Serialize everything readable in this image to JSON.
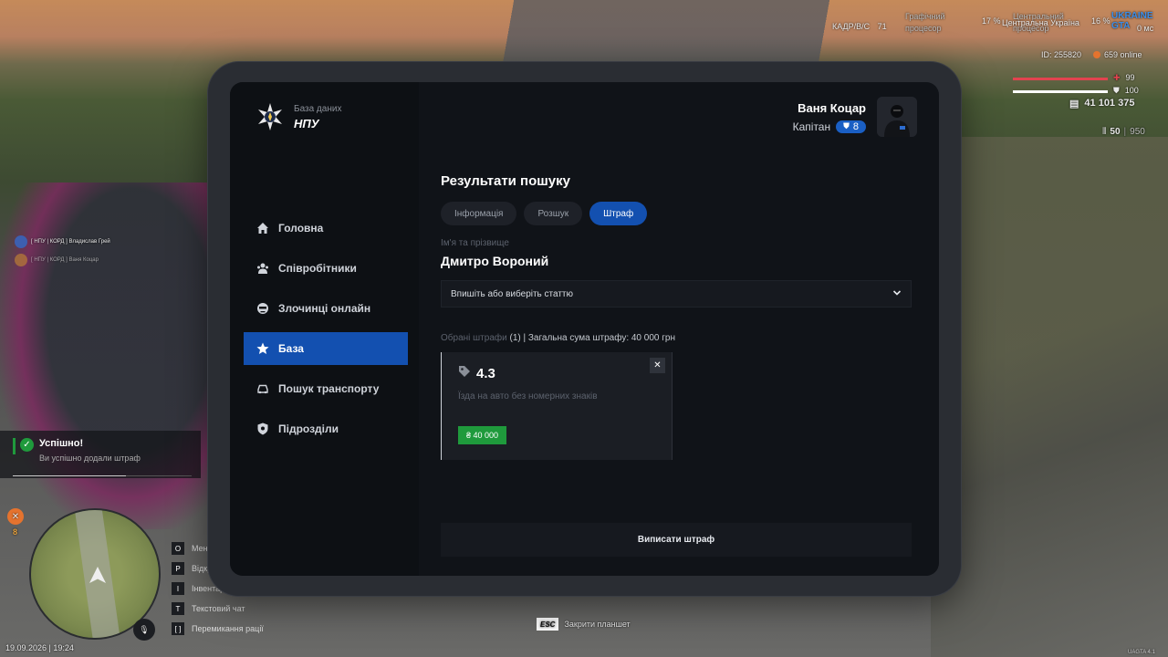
{
  "app": {
    "brand_subtitle": "База даних",
    "brand_title": "НПУ"
  },
  "user": {
    "name": "Ваня Коцар",
    "rank": "Капітан",
    "level": "8"
  },
  "sidebar": {
    "items": [
      {
        "label": "Головна",
        "icon": "home-icon"
      },
      {
        "label": "Співробітники",
        "icon": "users-icon"
      },
      {
        "label": "Злочинці онлайн",
        "icon": "criminal-icon"
      },
      {
        "label": "База",
        "icon": "star-icon",
        "active": true
      },
      {
        "label": "Пошук транспорту",
        "icon": "car-icon"
      },
      {
        "label": "Підрозділи",
        "icon": "shield-icon"
      }
    ]
  },
  "main": {
    "title": "Результати пошуку",
    "tabs": [
      {
        "label": "Інформація"
      },
      {
        "label": "Розшук"
      },
      {
        "label": "Штраф",
        "active": true
      }
    ],
    "name_label": "Ім'я та прізвище",
    "person_name": "Дмитро Вороний",
    "select_placeholder": "Впишіть або виберіть статтю",
    "summary_label": "Обрані штрафи",
    "summary_count": "(1)",
    "summary_total": "| Загальна сума штрафу: 40 000 грн",
    "fine": {
      "code": "4.3",
      "description": "Їзда на авто без номерних знаків",
      "amount": "₴ 40 000"
    },
    "submit_label": "Виписати штраф"
  },
  "hud": {
    "id_text": "ID: 255820",
    "online": "659 online",
    "health": "99",
    "armor": "100",
    "money": "41 101 375",
    "ammo": "50",
    "ammo_total": "950",
    "zone_label": "КАДР/В/С",
    "zone_value": "71",
    "region": "Центральна Україна",
    "percent1": "17 %",
    "percent2": "16 %",
    "logo": "UKRAINE GTA",
    "fps": "0 мс",
    "cpu1": "Графічний процесор",
    "cpu2": "Центральний процесор",
    "date": "19.09.2026 | 19:24",
    "minimap_count": "8",
    "esc_key": "ESC",
    "esc_label": "Закрити планшет",
    "version": "UAGTA 4.1"
  },
  "toast": {
    "title": "Успішно!",
    "message": "Ви успішно додали штраф"
  },
  "chat": [
    "[ НПУ | КОРД ] Владислав Грей",
    "[ НПУ | КОРД ] Ваня Коцар"
  ],
  "keys": [
    {
      "key": "O",
      "label": "Меню"
    },
    {
      "key": "P",
      "label": "Відкрити"
    },
    {
      "key": "I",
      "label": "Інвентар"
    },
    {
      "key": "T",
      "label": "Текстовий чат"
    },
    {
      "key": "[  ]",
      "label": "Перемикання рації"
    }
  ],
  "colors": {
    "accent": "#1350b0",
    "success": "#1f9a3c",
    "panel": "#101318"
  }
}
